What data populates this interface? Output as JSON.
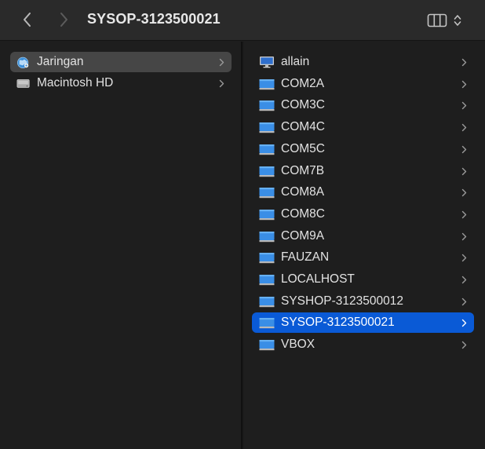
{
  "window": {
    "title": "SYSOP-3123500021"
  },
  "toolbar": {
    "back_icon": "chevron-left-icon",
    "forward_icon": "chevron-right-icon",
    "view_icon": "column-view-icon"
  },
  "sidebar_column": {
    "items": [
      {
        "label": "Jaringan",
        "icon": "network-globe-icon",
        "selected": true
      },
      {
        "label": "Macintosh HD",
        "icon": "hard-drive-icon",
        "selected": false
      }
    ]
  },
  "network_column": {
    "items": [
      {
        "label": "allain",
        "icon": "computer-icon",
        "selected": false
      },
      {
        "label": "COM2A",
        "icon": "computer-icon",
        "selected": false
      },
      {
        "label": "COM3C",
        "icon": "computer-icon",
        "selected": false
      },
      {
        "label": "COM4C",
        "icon": "computer-icon",
        "selected": false
      },
      {
        "label": "COM5C",
        "icon": "computer-icon",
        "selected": false
      },
      {
        "label": "COM7B",
        "icon": "computer-icon",
        "selected": false
      },
      {
        "label": "COM8A",
        "icon": "computer-icon",
        "selected": false
      },
      {
        "label": "COM8C",
        "icon": "computer-icon",
        "selected": false
      },
      {
        "label": "COM9A",
        "icon": "computer-icon",
        "selected": false
      },
      {
        "label": "FAUZAN",
        "icon": "computer-icon",
        "selected": false
      },
      {
        "label": "LOCALHOST",
        "icon": "computer-icon",
        "selected": false
      },
      {
        "label": "SYSHOP-3123500012",
        "icon": "computer-icon",
        "selected": false
      },
      {
        "label": "SYSOP-3123500021",
        "icon": "computer-icon",
        "selected": true
      },
      {
        "label": "VBOX",
        "icon": "computer-icon",
        "selected": false
      }
    ]
  },
  "colors": {
    "selection_accent": "#0a5ad6",
    "sidebar_selection": "#464646",
    "background": "#1e1e1e",
    "toolbar": "#2a2a2a"
  }
}
